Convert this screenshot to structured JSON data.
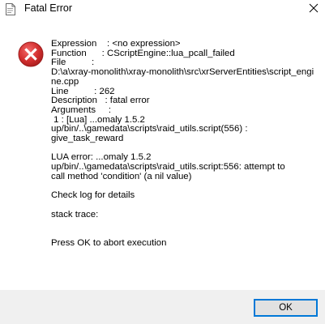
{
  "window": {
    "title": "Fatal Error",
    "title_icon": "app-document-icon",
    "close_icon": "close-icon"
  },
  "dialog": {
    "icon": "error-icon",
    "icon_color": "#d32f2f",
    "message": "Expression    : <no expression>\nFunction      : CScriptEngine::lua_pcall_failed\nFile          :\nD:\\a\\xray-monolith\\xray-monolith\\src\\xrServerEntities\\script_engine.cpp\nLine          : 262\nDescription   : fatal error\nArguments     :\n 1 : [Lua] ...omaly 1.5.2\nup/bin/..\\gamedata\\scripts\\raid_utils.script(556) :\ngive_task_reward\n\nLUA error: ...omaly 1.5.2\nup/bin/..\\gamedata\\scripts\\raid_utils.script:556: attempt to\ncall method 'condition' (a nil value)\n\nCheck log for details\n\nstack trace:\n\n\nPress OK to abort execution"
  },
  "footer": {
    "ok_label": "OK",
    "accent": "#0078d7"
  }
}
